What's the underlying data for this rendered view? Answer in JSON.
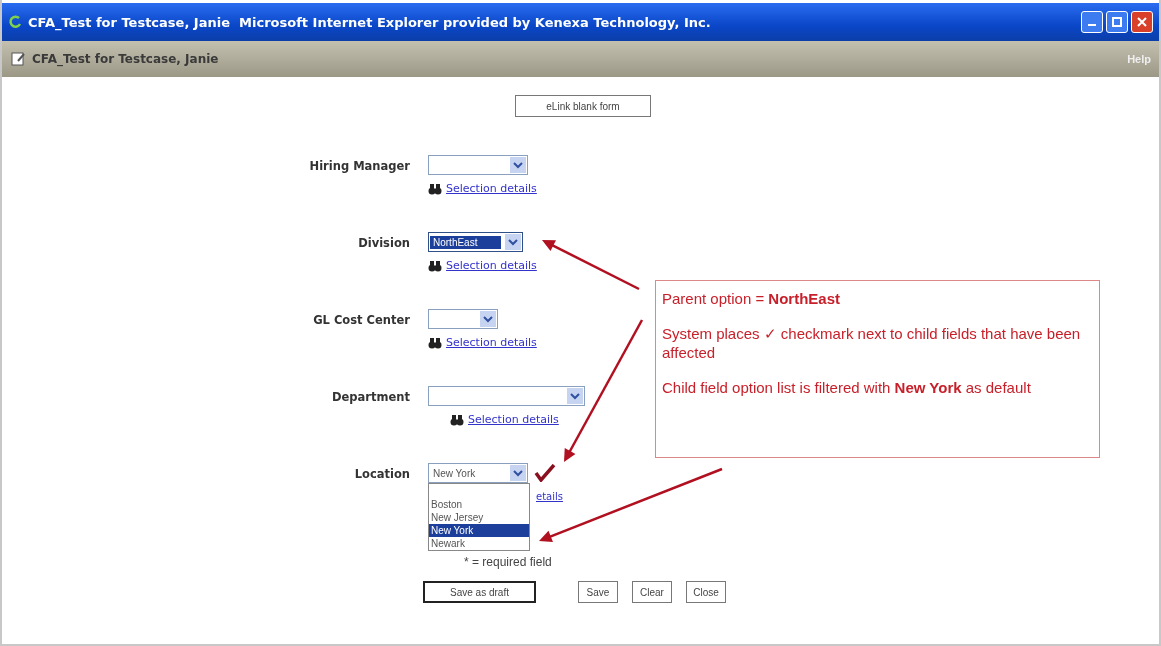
{
  "window": {
    "title": "CFA_Test for Testcase, Janie  Microsoft Internet Explorer provided by Kenexa Technology, Inc."
  },
  "page_header": {
    "title": "CFA_Test for Testcase, Janie",
    "help": "Help"
  },
  "top_button": "eLink blank form",
  "fields": [
    {
      "label": "Hiring Manager",
      "link": "Selection details",
      "focused": false,
      "affected": false,
      "open": false
    },
    {
      "label": "Division",
      "value": "NorthEast",
      "link": "Selection details",
      "focused": true,
      "affected": false,
      "open": false
    },
    {
      "label": "GL Cost Center",
      "link": "Selection details",
      "focused": false,
      "affected": false,
      "open": false
    },
    {
      "label": "Department",
      "link": "Selection details",
      "focused": false,
      "affected": false,
      "open": false
    },
    {
      "label": "Location",
      "value": "New York",
      "link": "etails",
      "focused": false,
      "affected": true,
      "open": true,
      "options": [
        {
          "label": "Boston",
          "selected": false
        },
        {
          "label": "New Jersey",
          "selected": false
        },
        {
          "label": "New York",
          "selected": true
        },
        {
          "label": "Newark",
          "selected": false
        }
      ]
    }
  ],
  "required_note": "* = required field",
  "buttons": [
    {
      "label": "Save as draft",
      "default": true
    },
    {
      "label": "Save",
      "default": false
    },
    {
      "label": "Clear",
      "default": false
    },
    {
      "label": "Close",
      "default": false
    }
  ],
  "callout": {
    "paragraphs": [
      "Parent option = **NorthEast**",
      "System places ✓ checkmark next to child fields that have been affected",
      "Child field option list is filtered with **New York** as default"
    ]
  }
}
